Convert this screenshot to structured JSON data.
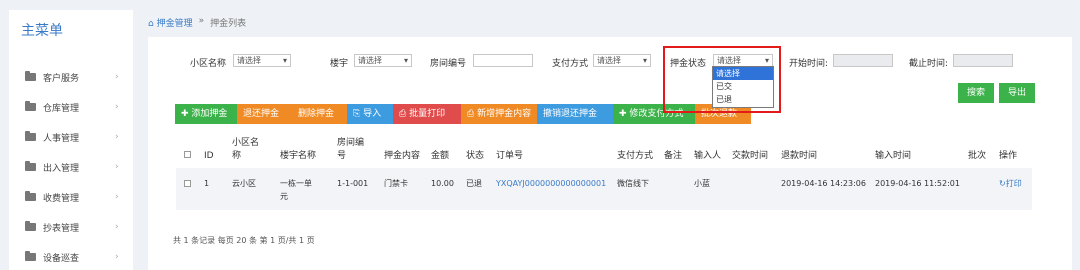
{
  "sidebar": {
    "title": "主菜单",
    "items": [
      {
        "label": "客户服务"
      },
      {
        "label": "仓库管理"
      },
      {
        "label": "人事管理"
      },
      {
        "label": "出入管理"
      },
      {
        "label": "收费管理"
      },
      {
        "label": "抄表管理"
      },
      {
        "label": "设备巡查"
      }
    ]
  },
  "breadcrumb": {
    "home": "押金管理",
    "sep": "»",
    "current": "押金列表"
  },
  "filters": {
    "community_label": "小区名称",
    "community_value": "请选择",
    "building_label": "楼宇",
    "building_value": "请选择",
    "room_label": "房间编号",
    "pay_label": "支付方式",
    "pay_value": "请选择",
    "status_label": "押金状态",
    "status_value": "请选择",
    "start_label": "开始时间:",
    "end_label": "截止时间:",
    "status_options": [
      "请选择",
      "已交",
      "已退"
    ]
  },
  "toolbar": {
    "add": "✚ 添加押金",
    "refund": "退还押金",
    "delete": "删除押金",
    "import": "导入",
    "print": "批量打印",
    "new_content": "新增押金内容",
    "cancel_refund": "撤销退还押金",
    "modify_pay": "✚ 修改支付方式",
    "batch_refund": "批次退款",
    "search": "搜索",
    "export": "导出"
  },
  "table": {
    "headers": [
      "ID",
      "小区名称",
      "楼宇名称",
      "房间编号",
      "押金内容",
      "金额",
      "状态",
      "订单号",
      "支付方式",
      "备注",
      "输入人",
      "交款时间",
      "退款时间",
      "输入时间",
      "批次",
      "操作"
    ],
    "rows": [
      {
        "id": "1",
        "community": "云小区",
        "building": "一栋一单元",
        "room": "1-1-001",
        "content": "门禁卡",
        "amount": "10.00",
        "status": "已退",
        "order": "YXQAYJ0000000000000001",
        "pay": "微信线下",
        "note": "",
        "inputter": "小蓝",
        "pay_time": "",
        "refund_time": "2019-04-16 14:23:06",
        "input_time": "2019-04-16 11:52:01",
        "batch": "",
        "action": "打印"
      }
    ]
  },
  "pager": "共 1 条记录  每页 20 条  第 1 页/共 1 页",
  "colors": {
    "accent": "#3a7bc8",
    "green": "#3cb34a",
    "orange": "#f08a24",
    "red": "#e04b4b",
    "blue": "#3d9be0",
    "highlight": "#e31a1a"
  }
}
